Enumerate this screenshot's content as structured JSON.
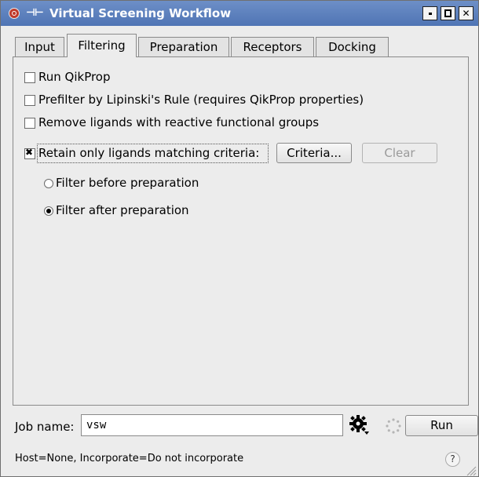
{
  "window": {
    "title": "Virtual Screening Workflow",
    "pin_glyph": "⊣⊢"
  },
  "tabs": [
    {
      "label": "Input"
    },
    {
      "label": "Filtering"
    },
    {
      "label": "Preparation"
    },
    {
      "label": "Receptors"
    },
    {
      "label": "Docking"
    }
  ],
  "active_tab": "Filtering",
  "options": {
    "run_qikprop": {
      "label": "Run QikProp",
      "checked": false
    },
    "prefilter_lipinski": {
      "label": "Prefilter by Lipinski's Rule (requires QikProp properties)",
      "checked": false
    },
    "remove_reactive": {
      "label": "Remove ligands with reactive functional groups",
      "checked": false
    },
    "retain_matching": {
      "label": "Retain only ligands matching criteria:",
      "checked": true
    }
  },
  "buttons": {
    "criteria": "Criteria...",
    "clear": "Clear",
    "run": "Run"
  },
  "filter_timing": {
    "options": [
      {
        "label": "Filter before preparation",
        "selected": false
      },
      {
        "label": "Filter after preparation",
        "selected": true
      }
    ]
  },
  "job": {
    "label": "Job name:",
    "value": "vsw"
  },
  "status_text": "Host=None, Incorporate=Do not incorporate",
  "help_glyph": "?",
  "icons": {
    "app": "schrodinger-app-icon",
    "pin": "pin-icon",
    "gear": "gear-icon",
    "spinner": "spinner-icon",
    "help": "help-icon"
  },
  "colors": {
    "titlebar": "#5a7dbd",
    "window_bg": "#ececec"
  }
}
